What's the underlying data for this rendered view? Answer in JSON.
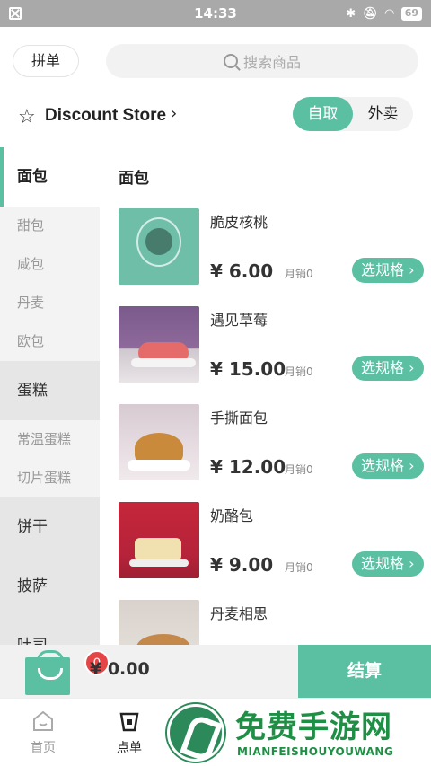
{
  "status": {
    "time": "14:33",
    "battery": "69"
  },
  "topbar": {
    "pin_label": "拼单",
    "search_placeholder": "搜索商品"
  },
  "store": {
    "name": "Discount Store",
    "modes": [
      "自取",
      "外卖"
    ],
    "active_mode": "自取"
  },
  "sidebar": {
    "items": [
      {
        "label": "面包",
        "type": "cat",
        "active": true
      },
      {
        "label": "甜包",
        "type": "sub"
      },
      {
        "label": "咸包",
        "type": "sub"
      },
      {
        "label": "丹麦",
        "type": "sub"
      },
      {
        "label": "欧包",
        "type": "sub"
      },
      {
        "label": "蛋糕",
        "type": "cat"
      },
      {
        "label": "常温蛋糕",
        "type": "sub"
      },
      {
        "label": "切片蛋糕",
        "type": "sub"
      },
      {
        "label": "饼干",
        "type": "cat"
      },
      {
        "label": "披萨",
        "type": "cat"
      },
      {
        "label": "吐司",
        "type": "cat"
      }
    ]
  },
  "main": {
    "section_title": "面包",
    "products": [
      {
        "name": "脆皮核桃",
        "price": "¥ 6.00",
        "sales": "月销0",
        "button": "选规格"
      },
      {
        "name": "遇见草莓",
        "price": "¥ 15.00",
        "sales": "月销0",
        "button": "选规格"
      },
      {
        "name": "手撕面包",
        "price": "¥ 12.00",
        "sales": "月销0",
        "button": "选规格"
      },
      {
        "name": "奶酪包",
        "price": "¥ 9.00",
        "sales": "月销0",
        "button": "选规格"
      },
      {
        "name": "丹麦相思",
        "price": "",
        "sales": "",
        "button": ""
      }
    ]
  },
  "cart": {
    "badge": "0",
    "total": "¥ 0.00",
    "checkout_label": "结算"
  },
  "tabs": [
    {
      "label": "首页"
    },
    {
      "label": "点单"
    }
  ],
  "watermark": {
    "title": "免费手游网",
    "subtitle": "MIANFEISHOUYOUWANG"
  },
  "colors": {
    "accent": "#5bbfa2",
    "badge": "#e54545",
    "watermark": "#1f8f45"
  }
}
